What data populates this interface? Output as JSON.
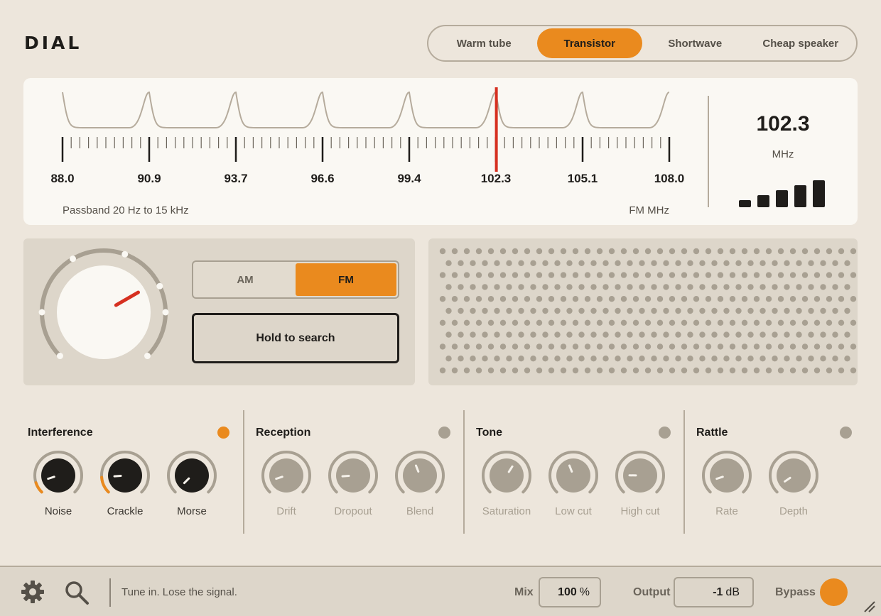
{
  "app": {
    "logo": "DIAL"
  },
  "presets": [
    {
      "label": "Warm tube",
      "active": false
    },
    {
      "label": "Transistor",
      "active": true
    },
    {
      "label": "Shortwave",
      "active": false
    },
    {
      "label": "Cheap speaker",
      "active": false
    }
  ],
  "dial": {
    "scale_labels": [
      "88.0",
      "90.9",
      "93.7",
      "96.6",
      "99.4",
      "102.3",
      "105.1",
      "108.0"
    ],
    "passband": "Passband 20 Hz to 15 kHz",
    "band_unit": "FM  MHz",
    "readout": "102.3",
    "readout_unit": "MHz",
    "needle_frequency": 102.3,
    "scale_min": 88.0,
    "scale_max": 108.0,
    "signal_strength": 5,
    "signal_max": 5,
    "needle_color": "#d63020"
  },
  "tuner": {
    "band_am": "AM",
    "band_fm": "FM",
    "active_band": "FM",
    "search_label": "Hold to search"
  },
  "sections": [
    {
      "title": "Interference",
      "active": true,
      "knobs": [
        {
          "label": "Noise",
          "value": 0.1
        },
        {
          "label": "Crackle",
          "value": 0.15
        },
        {
          "label": "Morse",
          "value": 0.0
        }
      ]
    },
    {
      "title": "Reception",
      "active": false,
      "knobs": [
        {
          "label": "Drift",
          "value": 0.1
        },
        {
          "label": "Dropout",
          "value": 0.15
        },
        {
          "label": "Blend",
          "value": 0.42
        }
      ]
    },
    {
      "title": "Tone",
      "active": false,
      "knobs": [
        {
          "label": "Saturation",
          "value": 0.62
        },
        {
          "label": "Low cut",
          "value": 0.42
        },
        {
          "label": "High cut",
          "value": 0.17
        }
      ]
    },
    {
      "title": "Rattle",
      "active": false,
      "knobs": [
        {
          "label": "Rate",
          "value": 0.1
        },
        {
          "label": "Depth",
          "value": 0.04
        }
      ]
    }
  ],
  "footer": {
    "tagline": "Tune in. Lose the signal.",
    "mix_label": "Mix",
    "mix_value": "100",
    "mix_unit": "%",
    "output_label": "Output",
    "output_value": "-1",
    "output_unit": "dB",
    "bypass_label": "Bypass"
  },
  "colors": {
    "accent": "#ea8a1e",
    "led_on": "#ea8a1e",
    "led_off": "#a8a092",
    "needle": "#d63020"
  },
  "icons": [
    "gear-icon",
    "search-icon",
    "resize-grip-icon"
  ]
}
